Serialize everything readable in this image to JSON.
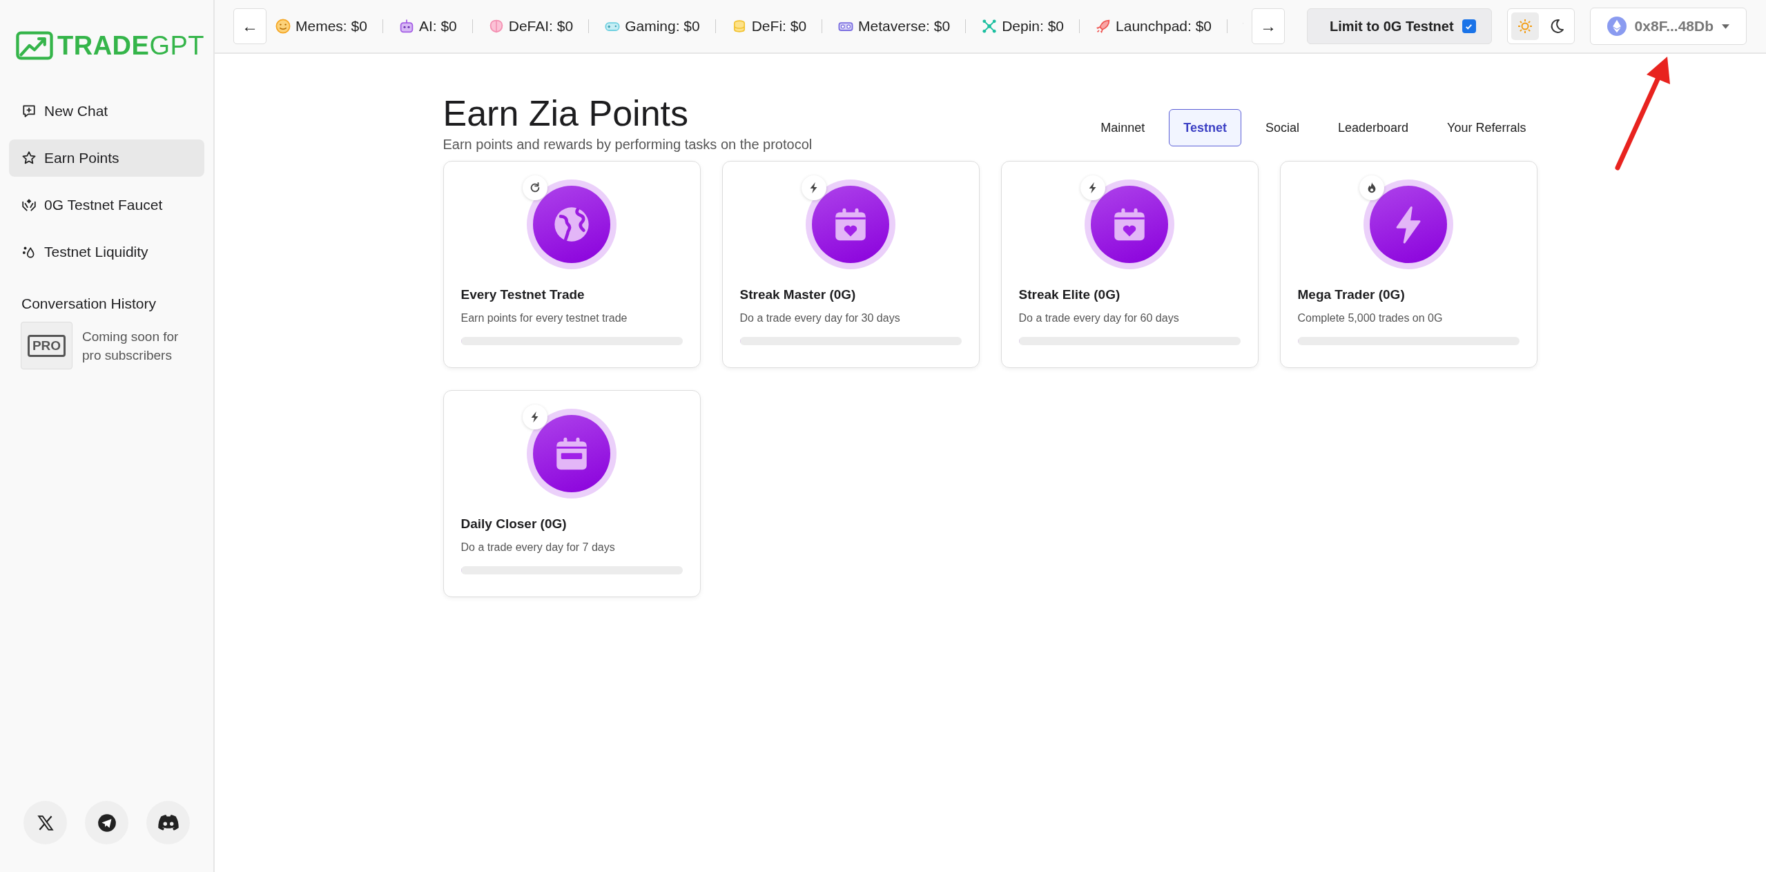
{
  "sidebar": {
    "logo": {
      "strong": "TRADE",
      "light": "GPT"
    },
    "items": [
      {
        "kind": "new-chat",
        "label": "New Chat",
        "selected": false
      },
      {
        "kind": "star",
        "label": "Earn Points",
        "selected": true
      },
      {
        "kind": "faucet",
        "label": "0G Testnet Faucet",
        "selected": false
      },
      {
        "kind": "drops",
        "label": "Testnet Liquidity",
        "selected": false
      }
    ],
    "history_heading": "Conversation History",
    "pro_badge": "PRO",
    "pro_note": "Coming soon for pro subscribers",
    "socials": [
      {
        "kind": "x"
      },
      {
        "kind": "telegram"
      },
      {
        "kind": "discord"
      }
    ]
  },
  "topbar": {
    "prev": "←",
    "next": "→",
    "ticker": [
      {
        "kind": "memes",
        "label": "Memes: $0"
      },
      {
        "kind": "ai",
        "label": "AI: $0"
      },
      {
        "kind": "defai",
        "label": "DeFAI: $0"
      },
      {
        "kind": "gaming",
        "label": "Gaming: $0"
      },
      {
        "kind": "defi",
        "label": "DeFi: $0"
      },
      {
        "kind": "metaverse",
        "label": "Metaverse: $0"
      },
      {
        "kind": "depin",
        "label": "Depin: $0"
      },
      {
        "kind": "launchpad",
        "label": "Launchpad: $0"
      },
      {
        "kind": "dice"
      }
    ],
    "limit": {
      "label": "Limit to 0G Testnet",
      "checked": true
    },
    "theme": [
      {
        "kind": "light",
        "selected": true
      },
      {
        "kind": "dark",
        "selected": false
      }
    ],
    "wallet": "0x8F...48Db"
  },
  "page": {
    "title": "Earn Zia Points",
    "subtitle": "Earn points and rewards by performing tasks on the protocol",
    "tabs": [
      {
        "label": "Mainnet",
        "selected": false
      },
      {
        "label": "Testnet",
        "selected": true
      },
      {
        "label": "Social",
        "selected": false
      },
      {
        "label": "Leaderboard",
        "selected": false
      },
      {
        "label": "Your Referrals",
        "selected": false
      }
    ],
    "tasks": [
      {
        "kind": "globe",
        "title": "Every Testnet Trade",
        "description": "Earn points for every testnet trade",
        "level": 0
      },
      {
        "kind": "calendar-heart",
        "title": "Streak Master (0G)",
        "description": "Do a trade every day for 30 days",
        "level": 0
      },
      {
        "kind": "calendar-heart",
        "title": "Streak Elite (0G)",
        "description": "Do a trade every day for 60 days",
        "level": 0
      },
      {
        "kind": "bolt",
        "title": "Mega Trader (0G)",
        "description": "Complete 5,000 trades on 0G",
        "level": 0
      },
      {
        "kind": "calendar-bar",
        "title": "Daily Closer (0G)",
        "description": "Do a trade every day for 7 days",
        "level": 0
      }
    ]
  },
  "annotation": {
    "kind": "arrow"
  }
}
